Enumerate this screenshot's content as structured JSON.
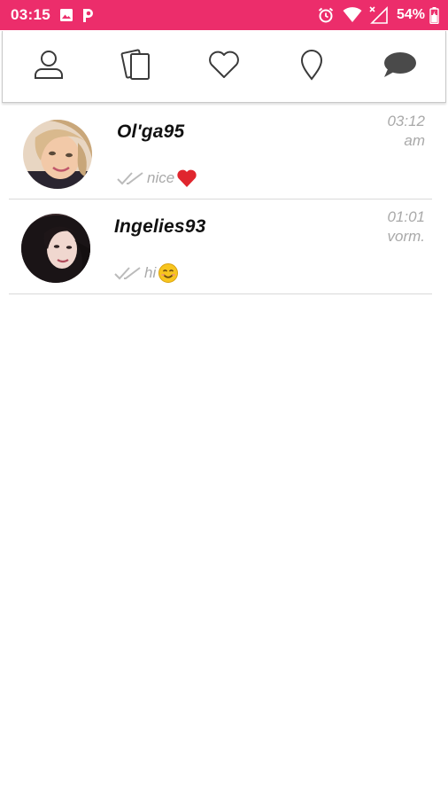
{
  "status_bar": {
    "time": "03:15",
    "battery": "54%",
    "icons": [
      "image-icon",
      "p-app-icon",
      "alarm-icon",
      "wifi-icon",
      "signal-icon",
      "battery-icon"
    ],
    "color": "#ec2d6b"
  },
  "nav": {
    "tabs": [
      "profile-icon",
      "cards-icon",
      "heart-icon",
      "location-pin-icon",
      "chat-icon"
    ],
    "active_tab": "chat-icon"
  },
  "chats": [
    {
      "name": "Ol'ga95",
      "time_line1": "03:12",
      "time_line2": "am",
      "preview": "nice",
      "preview_emoji": "heart-emoji"
    },
    {
      "name": "Ingelies93",
      "time_line1": "01:01",
      "time_line2": "vorm.",
      "preview": "hi",
      "preview_emoji": "smile-emoji"
    }
  ]
}
